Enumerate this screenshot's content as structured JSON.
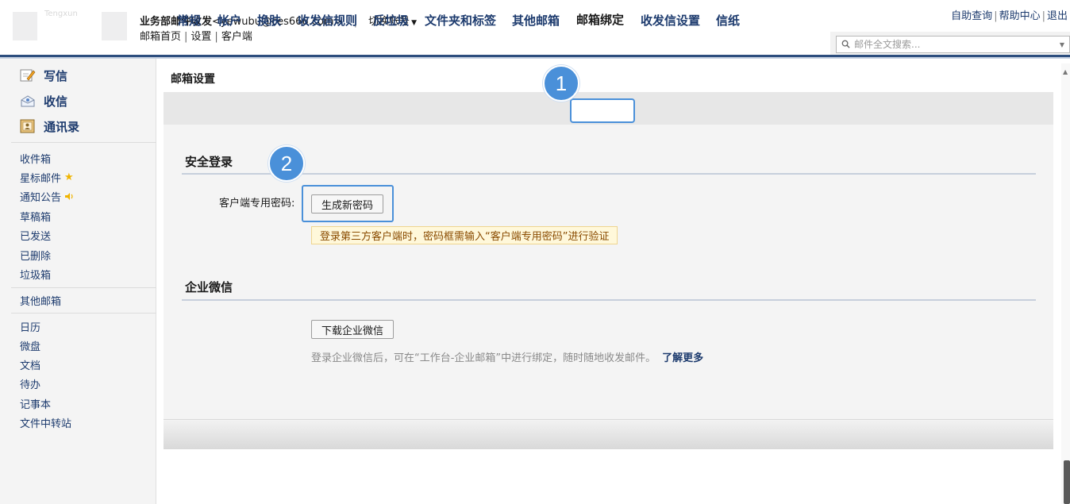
{
  "header": {
    "logo_text": "Tengxun",
    "account_name": "业务部邮件收发",
    "account_email": "<yewubu@ces666.com>",
    "separator": "|",
    "switch_account": "切换帐号",
    "links": [
      "邮箱首页",
      "设置",
      "客户端"
    ],
    "top_right": [
      "自助查询",
      "帮助中心",
      "退出"
    ],
    "search_placeholder": "邮件全文搜索..."
  },
  "sidebar": {
    "compose": "写信",
    "receive": "收信",
    "contacts": "通讯录",
    "folders": [
      "收件箱",
      "星标邮件",
      "通知公告",
      "草稿箱",
      "已发送",
      "已删除",
      "垃圾箱"
    ],
    "other_mailbox": "其他邮箱",
    "apps": [
      "日历",
      "微盘",
      "文档",
      "待办",
      "记事本",
      "文件中转站"
    ]
  },
  "main": {
    "title": "邮箱设置",
    "tabs": [
      "常规",
      "帐户",
      "换肤",
      "收发信规则",
      "反垃圾",
      "文件夹和标签",
      "其他邮箱",
      "邮箱绑定",
      "收发信设置",
      "信纸"
    ],
    "active_tab": "邮箱绑定",
    "badges": [
      "1",
      "2"
    ],
    "security": {
      "title": "安全登录",
      "label": "客户端专用密码:",
      "button": "生成新密码",
      "tip": "登录第三方客户端时，密码框需输入“客户端专用密码”进行验证"
    },
    "wechat": {
      "title": "企业微信",
      "button": "下载企业微信",
      "description": "登录企业微信后，可在“工作台-企业邮箱”中进行绑定，随时随地收发邮件。",
      "learn_more": "了解更多"
    }
  },
  "colors": {
    "accent_blue": "#4a90d9",
    "nav_blue": "#1d3b6e",
    "header_rule": "#2d4e7e",
    "tip_bg": "#fff8da"
  }
}
